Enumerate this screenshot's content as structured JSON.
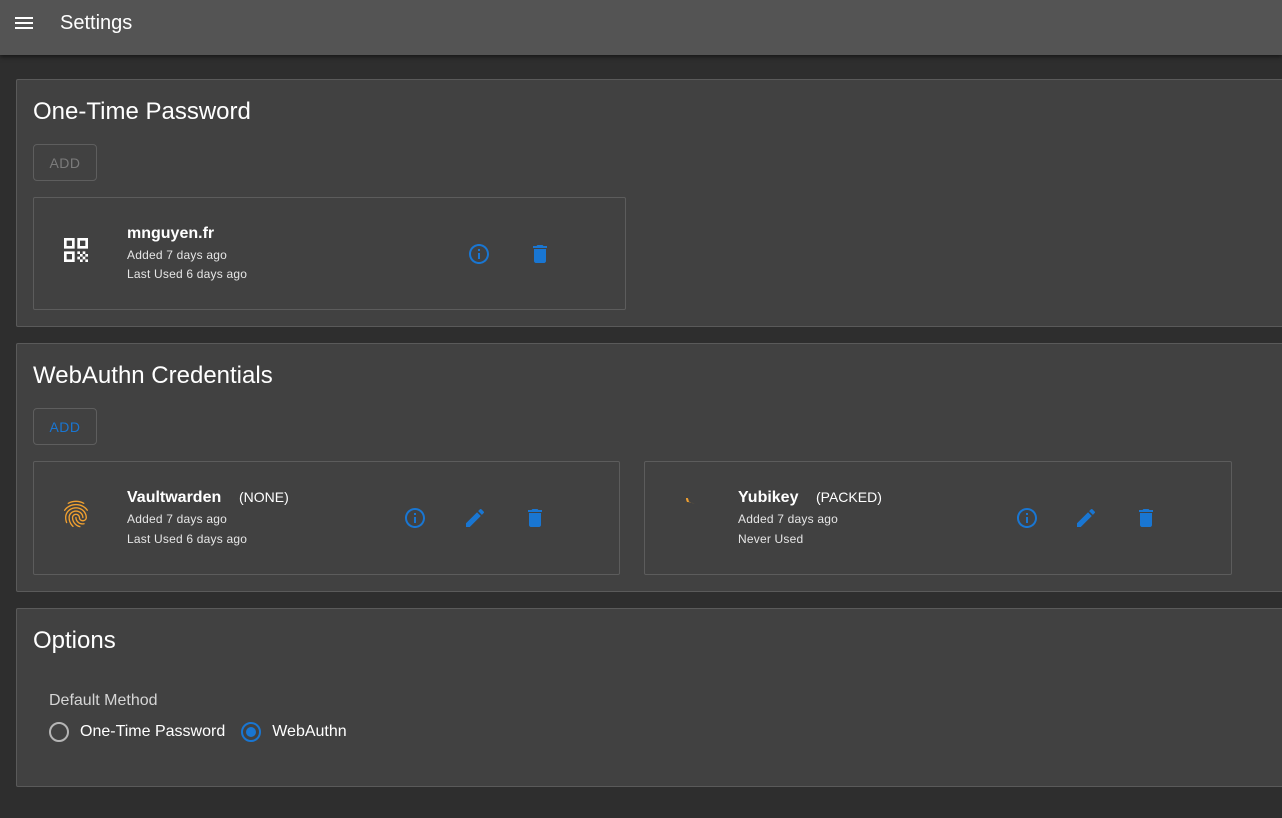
{
  "appbar": {
    "title": "Settings"
  },
  "otp": {
    "title": "One-Time Password",
    "add_label": "ADD",
    "credential": {
      "name": "mnguyen.fr",
      "added": "Added 7 days ago",
      "last_used": "Last Used 6 days ago"
    }
  },
  "webauthn": {
    "title": "WebAuthn Credentials",
    "add_label": "ADD",
    "credentials": [
      {
        "name": "Vaultwarden",
        "type": "(NONE)",
        "added": "Added 7 days ago",
        "last_used": "Last Used 6 days ago"
      },
      {
        "name": "Yubikey",
        "type": "(PACKED)",
        "added": "Added 7 days ago",
        "last_used": "Never Used"
      }
    ]
  },
  "options": {
    "title": "Options",
    "default_method_label": "Default Method",
    "methods": [
      "One-Time Password",
      "WebAuthn"
    ],
    "selected": "WebAuthn"
  },
  "colors": {
    "accent": "#1976d2",
    "fingerprint": "#f0a030",
    "appbar": "#545454",
    "background": "#2e2e2e",
    "panel": "#414141"
  },
  "icons": {
    "menu": "menu-icon",
    "qr": "qr-code-icon",
    "fingerprint": "fingerprint-icon",
    "info": "info-icon",
    "edit": "pencil-icon",
    "delete": "trash-icon"
  }
}
